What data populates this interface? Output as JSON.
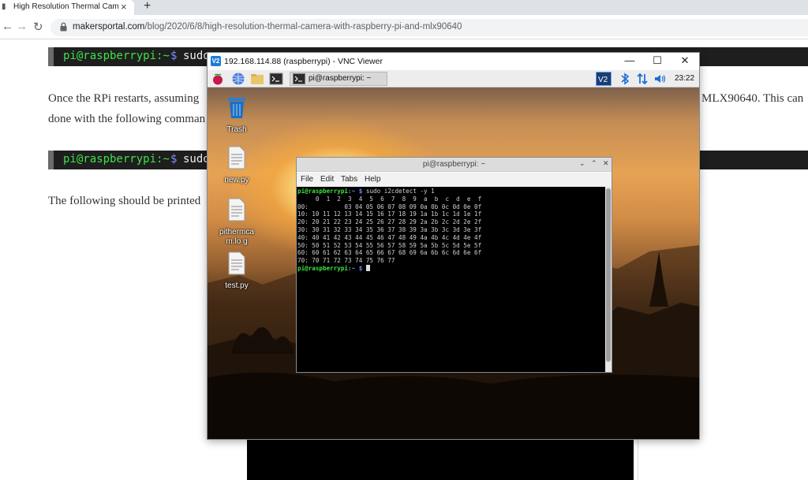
{
  "browser": {
    "tab_title": "High Resolution Thermal Camera",
    "tab_close": "×",
    "new_tab": "+",
    "url_domain": "makersportal.com",
    "url_path": "/blog/2020/6/8/high-resolution-thermal-camera-with-raspberry-pi-and-mlx90640",
    "icons": [
      "back-arrow-icon",
      "forward-arrow-icon",
      "reload-icon",
      "lock-icon"
    ]
  },
  "page": {
    "code1_prompt": "pi@raspberrypi:~",
    "code1_dollar": "$",
    "code1_cmd": "sudo",
    "para1_line1_left": "Once the RPi restarts, assuming",
    "para1_line1_right": "MLX90640. This can",
    "para1_line2": "done with the following comman",
    "code2_prompt": "pi@raspberrypi:~",
    "code2_dollar": "$",
    "code2_cmd": "sudo",
    "para2": "The following should be printed"
  },
  "vnc": {
    "title": "192.168.114.88 (raspberrypi) - VNC Viewer",
    "icon_text": "V2",
    "minimize": "—",
    "maximize": "☐",
    "close": "✕",
    "panel": {
      "taskbar_label": "pi@raspberrypi: ~",
      "clock": "23:22",
      "tray_icons": [
        "vnc-icon",
        "bluetooth-icon",
        "network-icon",
        "volume-icon"
      ]
    },
    "desktop_icons": [
      {
        "label": "Trash"
      },
      {
        "label": "new.py"
      },
      {
        "label": "pithermcam.lo g"
      },
      {
        "label": "test.py"
      }
    ],
    "terminal": {
      "title": "pi@raspberrypi: ~",
      "controls": [
        "⌄",
        "⌃",
        "✕"
      ],
      "menu": [
        "File",
        "Edit",
        "Tabs",
        "Help"
      ],
      "prompt_user": "pi@raspberrypi",
      "prompt_path": ":~ $",
      "command": " sudo i2cdetect -y 1",
      "output": [
        "     0  1  2  3  4  5  6  7  8  9  a  b  c  d  e  f",
        "00:          03 04 05 06 07 08 09 0a 0b 0c 0d 0e 0f",
        "10: 10 11 12 13 14 15 16 17 18 19 1a 1b 1c 1d 1e 1f",
        "20: 20 21 22 23 24 25 26 27 28 29 2a 2b 2c 2d 2e 2f",
        "30: 30 31 32 33 34 35 36 37 38 39 3a 3b 3c 3d 3e 3f",
        "40: 40 41 42 43 44 45 46 47 48 49 4a 4b 4c 4d 4e 4f",
        "50: 50 51 52 53 54 55 56 57 58 59 5a 5b 5c 5d 5e 5f",
        "60: 60 61 62 63 64 65 66 67 68 69 6a 6b 6c 6d 6e 6f",
        "70: 70 71 72 73 74 75 76 77"
      ]
    }
  }
}
